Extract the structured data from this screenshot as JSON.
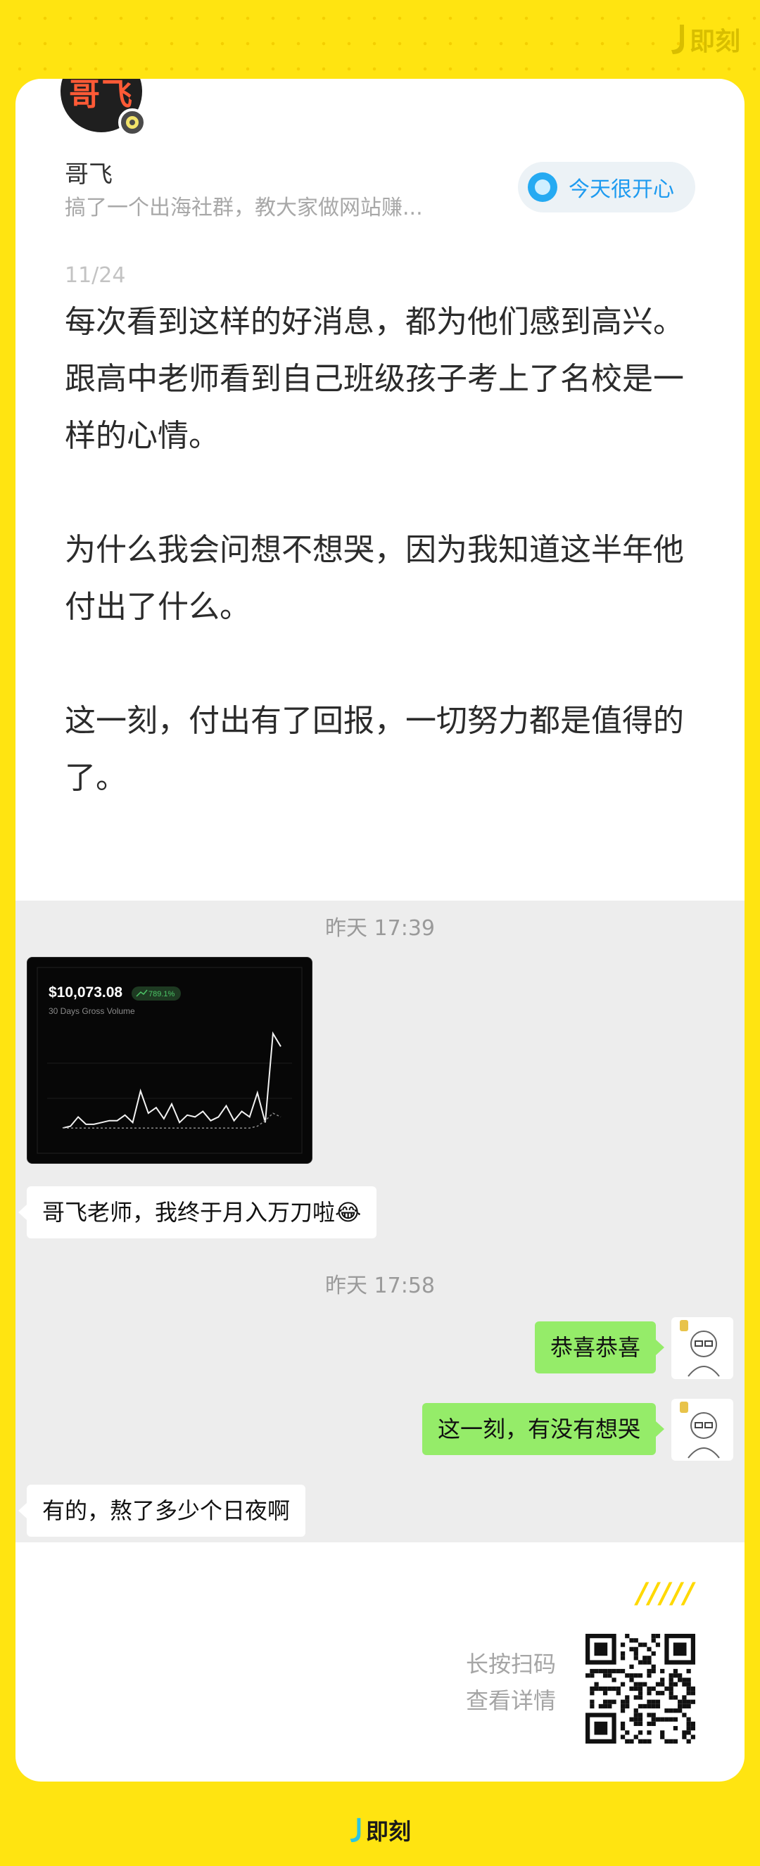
{
  "brand": {
    "name": "即刻"
  },
  "author": {
    "avatar_text": "哥飞",
    "name": "哥飞",
    "bio": "搞了一个出海社群，教大家做网站赚..."
  },
  "topic": {
    "label": "今天很开心"
  },
  "post": {
    "date": "11/24",
    "body": "每次看到这样的好消息，都为他们感到高兴。\n跟高中老师看到自己班级孩子考上了名校是一样的心情。\n\n为什么我会问想不想哭，因为我知道这半年他付出了什么。\n\n这一刻，付出有了回报，一切努力都是值得的了。"
  },
  "chat": {
    "time1": "昨天 17:39",
    "chart_image": {
      "amount": "$10,073.08",
      "change": "789.1%",
      "caption": "30 Days Gross Volume",
      "chart_data": {
        "type": "line",
        "series": [
          {
            "values": [
              6,
              7,
              12,
              8,
              8,
              9,
              10,
              10,
              13,
              9,
              26,
              14,
              17,
              11,
              19,
              9,
              13,
              12,
              15,
              10,
              12,
              18,
              10,
              15,
              12,
              25,
              9,
              57,
              50
            ]
          },
          {
            "values": [
              6,
              6,
              6,
              6,
              6,
              6,
              6,
              6,
              6,
              6,
              6,
              6,
              6,
              6,
              6,
              6,
              6,
              6,
              6,
              6,
              6,
              6,
              6,
              6,
              6,
              7,
              10,
              14,
              12
            ]
          }
        ]
      }
    },
    "msg1": "哥飞老师，我终于月入万刀啦😂",
    "time2": "昨天 17:58",
    "msg2": "恭喜恭喜",
    "msg3": "这一刻，有没有想哭",
    "msg4": "有的，熬了多少个日夜啊"
  },
  "footer": {
    "slashes": "/////",
    "scan_line1": "长按扫码",
    "scan_line2": "查看详情"
  }
}
